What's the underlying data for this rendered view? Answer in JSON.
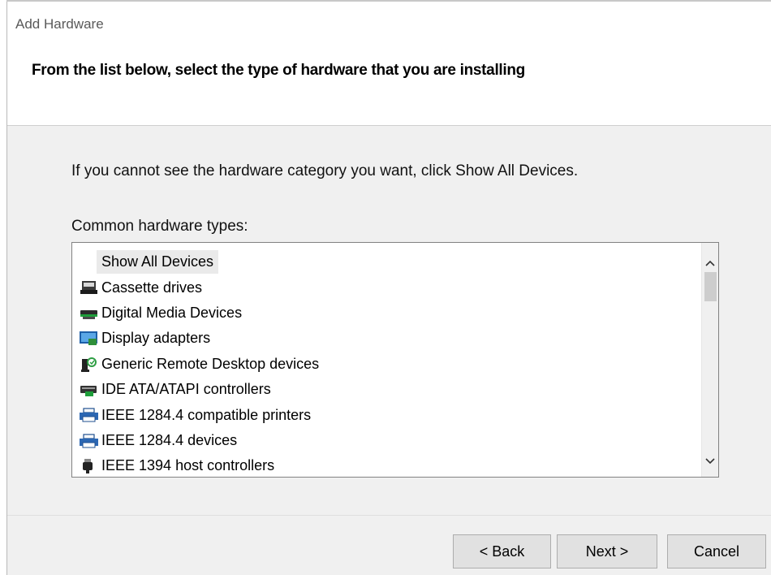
{
  "window": {
    "title": "Add Hardware"
  },
  "header": {
    "instruction": "From the list below, select the type of hardware that you are installing"
  },
  "main": {
    "hint": "If you cannot see the hardware category you want, click Show All Devices.",
    "list_label": "Common hardware types:",
    "items": [
      {
        "label": "Show All Devices",
        "icon": "none"
      },
      {
        "label": "Cassette drives",
        "icon": "cassette-drive-icon"
      },
      {
        "label": "Digital Media Devices",
        "icon": "digital-media-icon"
      },
      {
        "label": "Display adapters",
        "icon": "display-adapter-icon"
      },
      {
        "label": "Generic Remote Desktop devices",
        "icon": "remote-desktop-icon"
      },
      {
        "label": "IDE ATA/ATAPI controllers",
        "icon": "ide-controller-icon"
      },
      {
        "label": "IEEE 1284.4 compatible printers",
        "icon": "printer-icon"
      },
      {
        "label": "IEEE 1284.4 devices",
        "icon": "printer-icon"
      },
      {
        "label": "IEEE 1394 host controllers",
        "icon": "ieee1394-icon"
      }
    ]
  },
  "buttons": {
    "back": "< Back",
    "next": "Next >",
    "cancel": "Cancel"
  }
}
